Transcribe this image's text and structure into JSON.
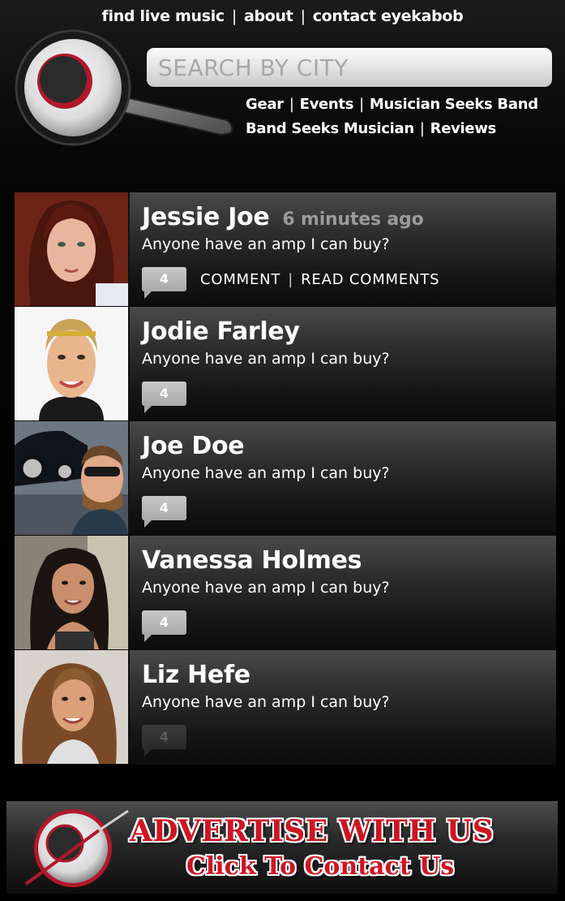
{
  "top_nav": {
    "find_live_music": "find live music",
    "about": "about",
    "contact": "contact eyekabob",
    "separator": "|"
  },
  "search": {
    "placeholder": "SEARCH BY CITY"
  },
  "category_nav": {
    "gear": "Gear",
    "events": "Events",
    "musician_seeks_band": "Musician Seeks Band",
    "band_seeks_musician": "Band Seeks Musician",
    "reviews": "Reviews"
  },
  "feed": [
    {
      "name": "Jessie Joe",
      "time": "6 minutes ago",
      "message": "Anyone have an amp I can buy?",
      "comment_count": "4",
      "comment_label": "COMMENT",
      "read_label": "READ COMMENTS"
    },
    {
      "name": "Jodie Farley",
      "message": "Anyone have an amp I can buy?",
      "comment_count": "4"
    },
    {
      "name": "Joe Doe",
      "message": "Anyone have an amp I can buy?",
      "comment_count": "4"
    },
    {
      "name": "Vanessa Holmes",
      "message": "Anyone have an amp I can buy?",
      "comment_count": "4"
    },
    {
      "name": "Liz Hefe",
      "message": "Anyone have an amp I can buy?",
      "comment_count": "4"
    }
  ],
  "ad": {
    "title": "ADVERTISE WITH US",
    "subtitle": "Click To Contact Us"
  },
  "colors": {
    "accent_red": "#d01422",
    "background": "#000000"
  }
}
